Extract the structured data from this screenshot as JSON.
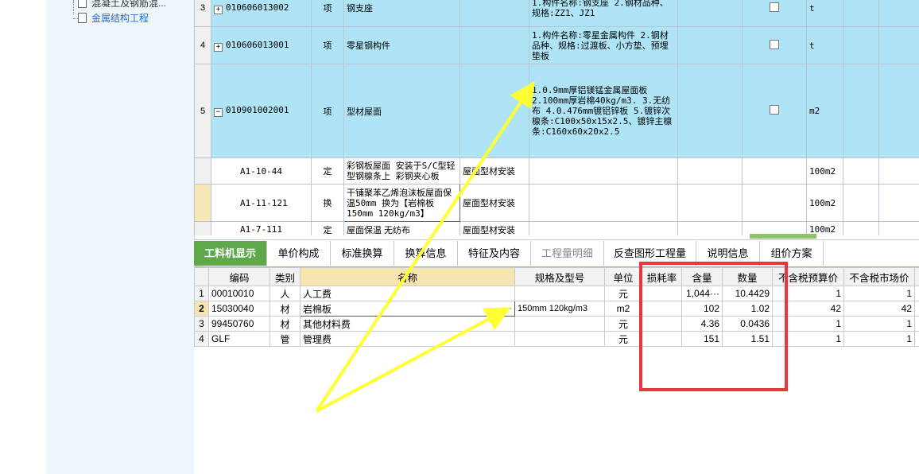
{
  "tree": {
    "items": [
      {
        "label": "混凝土及钢筋混..."
      },
      {
        "label": "金属结构工程"
      }
    ]
  },
  "upper_table": {
    "rows": [
      {
        "num": "3",
        "code": "010606013002",
        "type": "项",
        "name": "钢支座",
        "feature": "1.构件名称:钢支座\n2.钢材品种、规格:ZZ1、JZ1",
        "unit": "t",
        "expander": "+"
      },
      {
        "num": "4",
        "code": "010606013001",
        "type": "项",
        "name": "零星钢构件",
        "feature": "1.构件名称:零星金属构件\n2.钢材品种、规格:过渡板、小方垫、预埋垫板",
        "unit": "t",
        "expander": "+"
      },
      {
        "num": "5",
        "code": "010901002001",
        "type": "项",
        "name": "型材屋面",
        "feature": "1.0.9mm厚铝镁锰金属屋面板\n2.100mm厚岩棉40kg/m3.\n3.无纺布\n4.0.476mm镀铝锌板\n5.镀锌次檩条:C100x50x15x2.5、镀锌主檩条:C160x60x20x2.5",
        "unit": "m2",
        "expander": "−"
      }
    ],
    "subrows": [
      {
        "code": "A1-10-44",
        "type": "定",
        "name": "彩钢板屋面 安装于S/C型轻型钢檩条上 彩钢夹心板",
        "item": "屋面型材安装",
        "unit": "100m2"
      },
      {
        "code": "A1-11-121",
        "type": "换",
        "name": "干铺聚苯乙烯泡沫板屋面保温50mm 换为【岩棉板 150mm 120kg/m3】",
        "item": "屋面型材安装",
        "unit": "100m2"
      },
      {
        "code": "A1-7-111",
        "type": "定",
        "name": "屋面保温 无纺布",
        "item": "屋面型材安装",
        "unit": "100m2"
      }
    ]
  },
  "tabs": [
    {
      "label": "工料机显示",
      "state": "active"
    },
    {
      "label": "单价构成",
      "state": "normal"
    },
    {
      "label": "标准换算",
      "state": "normal"
    },
    {
      "label": "换算信息",
      "state": "normal"
    },
    {
      "label": "特征及内容",
      "state": "normal"
    },
    {
      "label": "工程量明细",
      "state": "disabled"
    },
    {
      "label": "反查图形工程量",
      "state": "normal"
    },
    {
      "label": "说明信息",
      "state": "normal"
    },
    {
      "label": "组价方案",
      "state": "normal"
    }
  ],
  "lower_table": {
    "headers": [
      "编码",
      "类别",
      "名称",
      "规格及型号",
      "单位",
      "损耗率",
      "含量",
      "数量",
      "不含税预算价",
      "不含税市场价",
      "含"
    ],
    "rows": [
      {
        "num": "1",
        "code": "00010010",
        "cat": "人",
        "name": "人工费",
        "spec": "",
        "unit": "元",
        "loss": "",
        "content": "1,044···",
        "qty": "10.4429",
        "budget": "1",
        "market": "1"
      },
      {
        "num": "2",
        "code": "15030040",
        "cat": "材",
        "name": "岩棉板",
        "spec": "150mm 120kg/m3",
        "unit": "m2",
        "loss": "",
        "content": "102",
        "qty": "1.02",
        "budget": "42",
        "market": "42"
      },
      {
        "num": "3",
        "code": "99450760",
        "cat": "材",
        "name": "其他材料费",
        "spec": "",
        "unit": "元",
        "loss": "",
        "content": "4.36",
        "qty": "0.0436",
        "budget": "1",
        "market": "1"
      },
      {
        "num": "4",
        "code": "GLF",
        "cat": "管",
        "name": "管理费",
        "spec": "",
        "unit": "元",
        "loss": "",
        "content": "151",
        "qty": "1.51",
        "budget": "1",
        "market": "1"
      }
    ],
    "ellipsis": "···"
  },
  "colors": {
    "highlight_row": "#aee4f6",
    "active_tab": "#5fa84a",
    "annotation_arrow": "#ffff00",
    "annotation_box": "#e8363a"
  }
}
